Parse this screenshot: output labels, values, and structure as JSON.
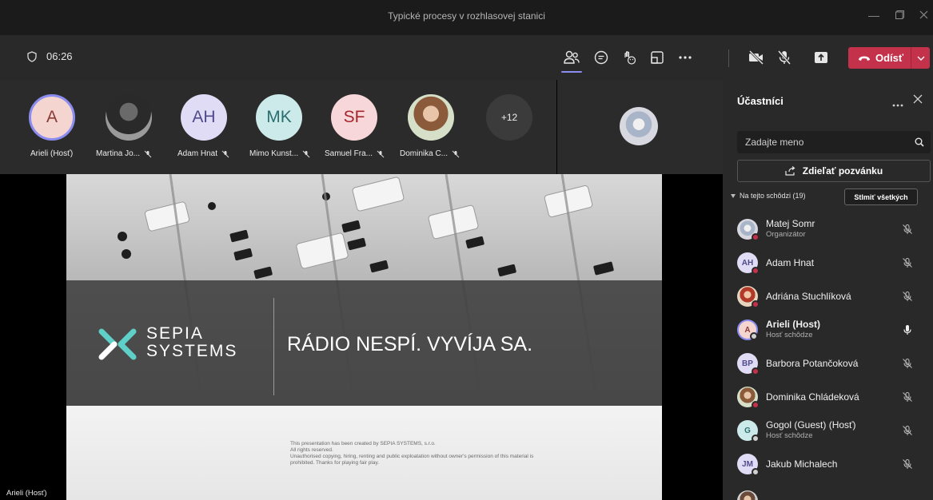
{
  "window": {
    "title": "Typické procesy v rozhlasovej stanici"
  },
  "toolbar": {
    "timer": "06:26",
    "leave_label": "Odísť"
  },
  "colors": {
    "accent": "#8b8cf0",
    "leave": "#c4314b",
    "panel": "#292929"
  },
  "stage": {
    "participants": [
      {
        "initials": "A",
        "label": "Arieli (Hosť)"
      },
      {
        "initials": "",
        "label": "Martina Jo..."
      },
      {
        "initials": "AH",
        "label": "Adam Hnat"
      },
      {
        "initials": "MK",
        "label": "Mimo Kunst..."
      },
      {
        "initials": "SF",
        "label": "Samuel Fra..."
      },
      {
        "initials": "",
        "label": "Dominika C..."
      }
    ],
    "overflow": "+12",
    "self_label": "Arieli (Hosť)"
  },
  "slide": {
    "brand_line1": "SEPIA",
    "brand_line2": "SYSTEMS",
    "headline": "RÁDIO NESPÍ. VYVÍJA SA.",
    "legal_line1": "This presentation has been created by SEPIA SYSTEMS, s.r.o.",
    "legal_line2": "All rights reserved.",
    "legal_line3": "Unauthorised copying, hiring, renting and public exploatation without owner's permission of this material is",
    "legal_line4": "prohibited. Thanks for playing fair play."
  },
  "panel": {
    "title": "Účastníci",
    "search_placeholder": "Zadajte meno",
    "share_label": "Zdieľať pozvánku",
    "section_label": "Na tejto schôdzi (19)",
    "mute_all_label": "Stlmiť všetkých",
    "people": [
      {
        "initials": "",
        "name": "Matej Somr",
        "role": "Organizátor"
      },
      {
        "initials": "AH",
        "name": "Adam Hnat",
        "role": ""
      },
      {
        "initials": "",
        "name": "Adriána Stuchlíková",
        "role": ""
      },
      {
        "initials": "A",
        "name": "Arieli (Host)",
        "role": "Hosť schôdze"
      },
      {
        "initials": "BP",
        "name": "Barbora Potančoková",
        "role": ""
      },
      {
        "initials": "",
        "name": "Dominika Chládeková",
        "role": ""
      },
      {
        "initials": "G",
        "name": "Gogol (Guest) (Hosť)",
        "role": "Hosť schôdze"
      },
      {
        "initials": "JM",
        "name": "Jakub Michalech",
        "role": ""
      }
    ]
  }
}
